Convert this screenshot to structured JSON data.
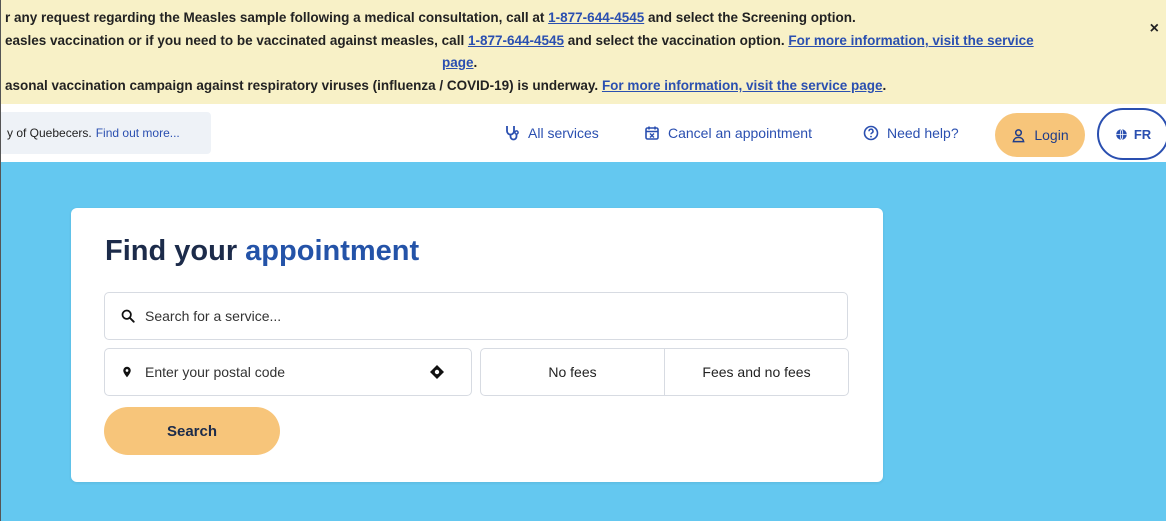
{
  "alert": {
    "line1_text": "r any request regarding the Measles sample following a medical consultation, call at ",
    "line1_phone": "1-877-644-4545",
    "line1_suffix": " and select the Screening option.",
    "line2_text": "easles vaccination or if you need to be vaccinated against measles, call ",
    "line2_phone": "1-877-644-4545",
    "line2_mid": " and select the vaccination option. ",
    "line2_link": "For more information, visit the service",
    "line2_link_cont": "page",
    "line2_end": ".",
    "line3_text": "asonal vaccination campaign against respiratory viruses (influenza / COVID-19) is underway. ",
    "line3_link": "For more information, visit the service page",
    "line3_end": ".",
    "close_label": "×"
  },
  "nav": {
    "promo_text": "y of Quebecers.",
    "promo_link": "Find out more...",
    "all_services": "All services",
    "cancel_appointment": "Cancel an appointment",
    "need_help": "Need help?",
    "login": "Login",
    "language": "FR"
  },
  "card": {
    "title_part1": "Find your ",
    "title_part2": "appointment",
    "search_placeholder": "Search for a service...",
    "postal_placeholder": "Enter your postal code",
    "fee_options": [
      "No fees",
      "Fees and no fees"
    ],
    "search_button": "Search"
  },
  "colors": {
    "alert_bg": "#f8f1c7",
    "hero_bg": "#64c8f0",
    "accent_blue": "#2453a8",
    "button_orange": "#f7c57a"
  },
  "icons": [
    "stethoscope-icon",
    "calendar-x-icon",
    "help-circle-icon",
    "user-icon",
    "globe-icon",
    "search-icon",
    "map-pin-icon",
    "locate-icon"
  ]
}
